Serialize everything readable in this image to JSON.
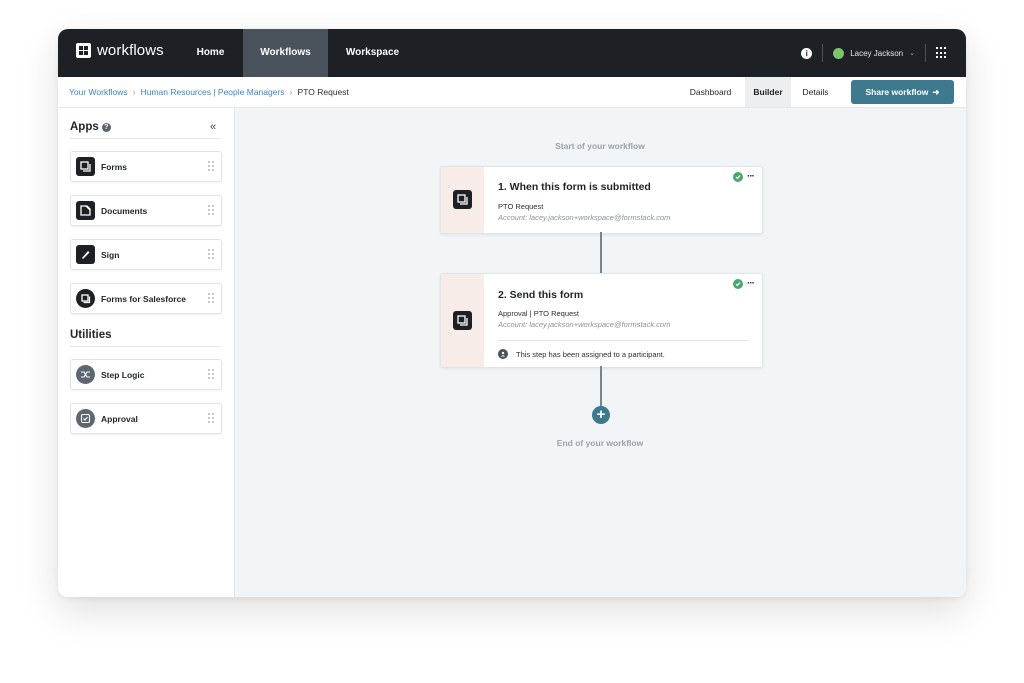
{
  "app": {
    "logo_text": "workflows",
    "nav": [
      "Home",
      "Workflows",
      "Workspace"
    ],
    "active_nav": "Workflows",
    "user_name": "Lacey Jackson",
    "accent_color": "#3e7a8e",
    "nav_bg_color": "#1d2126"
  },
  "breadcrumb": {
    "items": [
      "Your Workflows",
      "Human Resources | People Managers"
    ],
    "current": "PTO Request"
  },
  "tabs": {
    "dashboard": "Dashboard",
    "builder": "Builder",
    "details": "Details",
    "active": "Builder"
  },
  "share_button": {
    "label": "Share workflow",
    "icon": "arrow-right-icon"
  },
  "sidebar": {
    "apps_title": "Apps",
    "apps": [
      {
        "label": "Forms",
        "icon": "forms-icon"
      },
      {
        "label": "Documents",
        "icon": "documents-icon"
      },
      {
        "label": "Sign",
        "icon": "sign-pen-icon"
      },
      {
        "label": "Forms for Salesforce",
        "icon": "salesforce-forms-icon"
      }
    ],
    "utilities_title": "Utilities",
    "utilities": [
      {
        "label": "Step Logic",
        "icon": "shuffle-icon"
      },
      {
        "label": "Approval",
        "icon": "approval-check-icon"
      }
    ]
  },
  "canvas": {
    "start_label": "Start of your workflow",
    "end_label": "End of your workflow",
    "steps": [
      {
        "title": "1. When this form is submitted",
        "subtitle": "PTO Request",
        "account": "Account: lacey.jackson+workspace@formstack.com",
        "status": "complete"
      },
      {
        "title": "2. Send this form",
        "subtitle": "Approval | PTO Request",
        "account": "Account: lacey.jackson+workspace@formstack.com",
        "assignment": "This step has been assigned to a participant.",
        "status": "complete"
      }
    ]
  }
}
